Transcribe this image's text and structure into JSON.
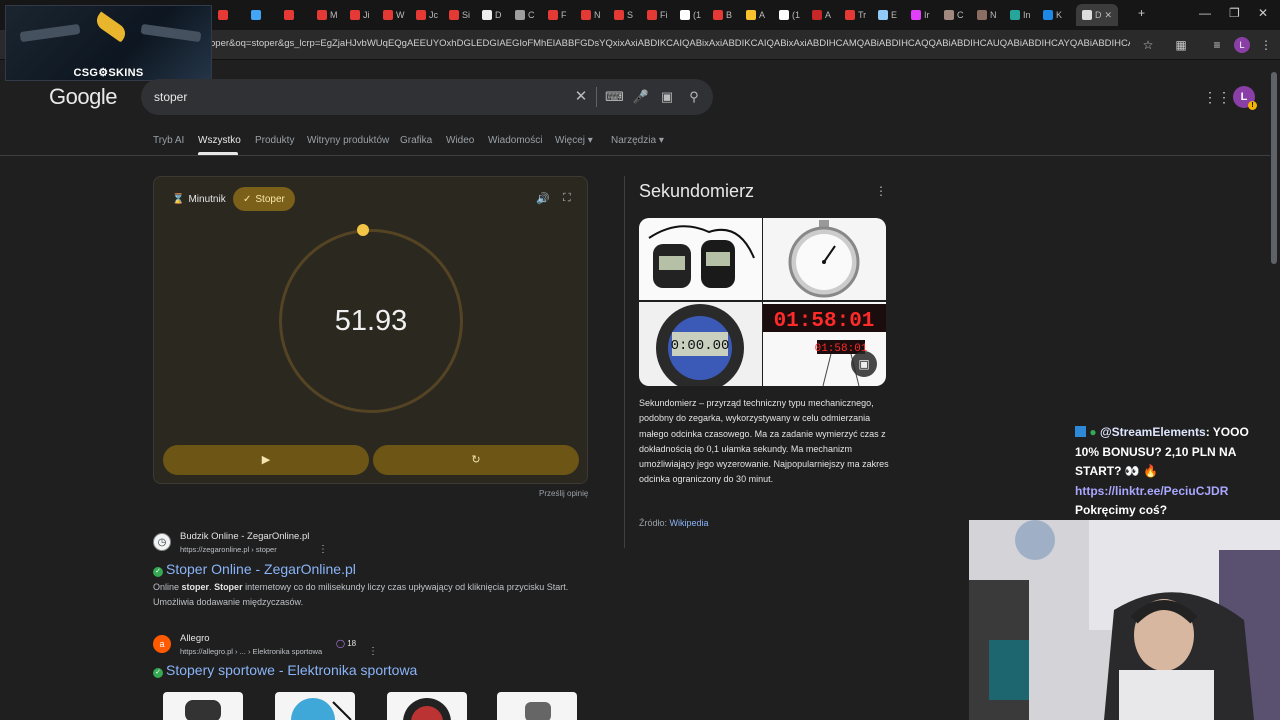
{
  "browser": {
    "tabs": [
      {
        "label": "",
        "color": "#e53935"
      },
      {
        "label": "",
        "color": "#42a5f5"
      },
      {
        "label": "",
        "color": "#e53935"
      },
      {
        "label": "M",
        "color": "#e53935"
      },
      {
        "label": "Ji",
        "color": "#e53935"
      },
      {
        "label": "W",
        "color": "#e53935"
      },
      {
        "label": "Jc",
        "color": "#e53935"
      },
      {
        "label": "Si",
        "color": "#e53935"
      },
      {
        "label": "D",
        "color": "#eeeeee"
      },
      {
        "label": "C",
        "color": "#9e9e9e"
      },
      {
        "label": "F",
        "color": "#e53935"
      },
      {
        "label": "N",
        "color": "#e53935"
      },
      {
        "label": "S",
        "color": "#e53935"
      },
      {
        "label": "Fi",
        "color": "#e53935"
      },
      {
        "label": "(1",
        "color": "#ffffff"
      },
      {
        "label": "B",
        "color": "#e53935"
      },
      {
        "label": "A",
        "color": "#fbc02d"
      },
      {
        "label": "(1",
        "color": "#ffffff"
      },
      {
        "label": "A",
        "color": "#c62828"
      },
      {
        "label": "Tr",
        "color": "#e53935"
      },
      {
        "label": "E",
        "color": "#90caf9"
      },
      {
        "label": "Ir",
        "color": "#e040fb"
      },
      {
        "label": "C",
        "color": "#a1887f"
      },
      {
        "label": "N",
        "color": "#8d6e63"
      },
      {
        "label": "In",
        "color": "#26a69a"
      },
      {
        "label": "K",
        "color": "#1e88e5"
      },
      {
        "label": "D",
        "color": "#dddddd"
      }
    ],
    "url": "oper&oq=stoper&gs_lcrp=EgZjaHJvbWUqEQgAEEUYOxhDGLEDGIAEGIoFMhEIABBFGDsYQxixAxiABDIKCAIQABixAxiABDIKCAIQABixAxiABDIHCAMQABiABDIHCAQQABiABDIHCAUQABiABDIHCAYQABiABDIHCAcQABiABDIHCAg",
    "profile_initial": "L"
  },
  "overlay": {
    "brand": "CSG⚙SKINS"
  },
  "google": {
    "logo": "Google",
    "query": "stoper",
    "avatar_initial": "L",
    "nav": [
      "Tryb AI",
      "Wszystko",
      "Produkty",
      "Witryny produktów",
      "Grafika",
      "Wideo",
      "Wiadomości",
      "Więcej",
      "Narzędzia"
    ]
  },
  "stopwatch": {
    "timer_label": "Minutnik",
    "stopwatch_label": "Stoper",
    "time": "51.93",
    "feedback": "Prześlij opinię"
  },
  "knowledge_panel": {
    "title": "Sekundomierz",
    "description": "Sekundomierz – przyrząd techniczny typu mechanicznego, podobny do zegarka, wykorzystywany w celu odmierzania małego odcinka czasowego. Ma za zadanie wymierzyć czas z dokładnością do 0,1 ułamka sekundy. Ma mechanizm umożliwiający jego wyzerowanie. Najpopularniejszy ma zakres odcinka ograniczony do 30 minut.",
    "source_label": "Źródło:",
    "source_link": "Wikipedia",
    "digital_display": "01:58:01",
    "small_display": "01:58:01",
    "lcd_display": "0:00.00"
  },
  "results": [
    {
      "site": "Budzik Online - ZegarOnline.pl",
      "url": "https://zegaronline.pl › stoper",
      "title": "Stoper Online - ZegarOnline.pl",
      "snippet_html": "Online <b>stoper</b>. <b>Stoper</b> internetowy co do milisekundy liczy czas upływający od kliknięcia przycisku Start. Umożliwia dodawanie międzyczasów."
    },
    {
      "site": "Allegro",
      "url": "https://allegro.pl › ... › Elektronika sportowa",
      "badge": "18",
      "title": "Stopery sportowe - Elektronika sportowa"
    }
  ],
  "chat": {
    "user": "@StreamElements",
    "message": ": YOOO 10% BONUSU? 2,10 PLN NA START? 👀 🔥",
    "link": "https://linktr.ee/PeciuCJDR",
    "question": "Pokręcimy coś?"
  }
}
